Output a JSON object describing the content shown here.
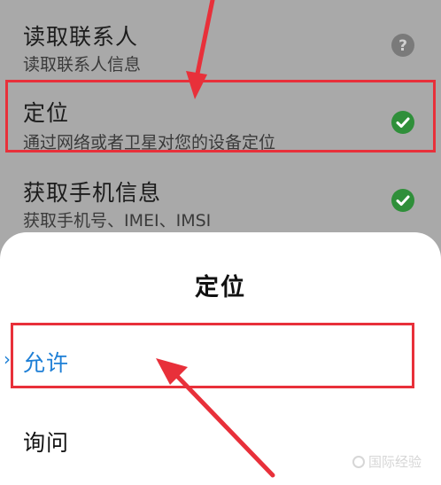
{
  "permissions": [
    {
      "title": "读取联系人",
      "desc": "读取联系人信息",
      "status_icon": "question-icon",
      "status_color": "#7a7a7a"
    },
    {
      "title": "定位",
      "desc": "通过网络或者卫星对您的设备定位",
      "status_icon": "check-circle-icon",
      "status_color": "#2f8f3a"
    },
    {
      "title": "获取手机信息",
      "desc": "获取手机号、IMEI、IMSI",
      "status_icon": "check-circle-icon",
      "status_color": "#2f8f3a"
    }
  ],
  "sheet": {
    "title": "定位",
    "options": [
      {
        "label": "允许",
        "selected": true,
        "color": "#1e7fd6"
      },
      {
        "label": "询问",
        "selected": false,
        "color": "#111111"
      }
    ]
  },
  "colors": {
    "highlight": "#e8303a"
  },
  "watermark": {
    "text": "国际经验"
  }
}
